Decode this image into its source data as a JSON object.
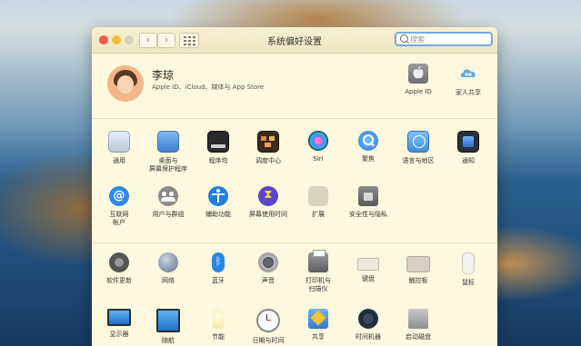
{
  "window": {
    "title": "系统偏好设置",
    "search_placeholder": "搜索"
  },
  "account": {
    "name": "李琼",
    "subtitle": "Apple ID、iCloud、媒体与 App Store",
    "apple_id_label": "Apple ID",
    "family_label": "家人共享"
  },
  "row1": [
    {
      "label": "通用"
    },
    {
      "label": "桌面与\n屏幕保护程序"
    },
    {
      "label": "程序坞"
    },
    {
      "label": "调度中心"
    },
    {
      "label": "Siri"
    },
    {
      "label": "聚焦"
    },
    {
      "label": "语言与地区"
    },
    {
      "label": "通知"
    }
  ],
  "row2": [
    {
      "label": "互联网\n帐户"
    },
    {
      "label": "用户与群组"
    },
    {
      "label": "辅助功能"
    },
    {
      "label": "屏幕使用时间"
    },
    {
      "label": "扩展"
    },
    {
      "label": "安全性与隐私"
    }
  ],
  "row3": [
    {
      "label": "软件更新"
    },
    {
      "label": "网络"
    },
    {
      "label": "蓝牙"
    },
    {
      "label": "声音"
    },
    {
      "label": "打印机与\n扫描仪"
    },
    {
      "label": "键盘"
    },
    {
      "label": "触控板"
    },
    {
      "label": "鼠标"
    }
  ],
  "row4": [
    {
      "label": "显示器"
    },
    {
      "label": "随航"
    },
    {
      "label": "节能"
    },
    {
      "label": "日期与时间"
    },
    {
      "label": "共享"
    },
    {
      "label": "时间机器"
    },
    {
      "label": "启动磁盘"
    }
  ],
  "colors": {
    "close": "#ee5a52",
    "minimize": "#f5bc30",
    "zoom": "#d8d2b8",
    "window_bg": "#fdf8de",
    "search_focus": "#78a8de"
  }
}
